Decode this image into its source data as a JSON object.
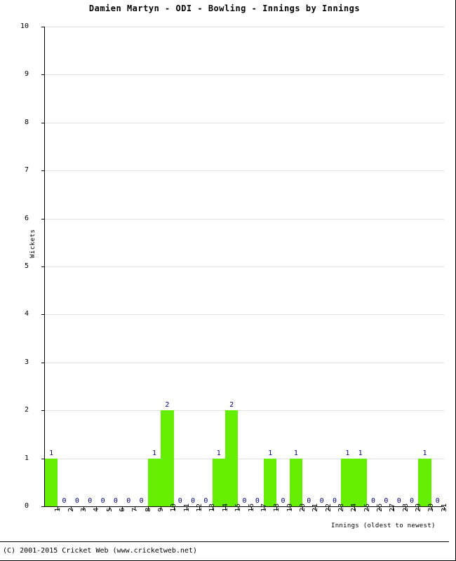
{
  "footer": {
    "copyright": "(C) 2001-2015 Cricket Web (www.cricketweb.net)"
  },
  "colors": {
    "bar": "#66EE00",
    "value_label": "#000080",
    "axis": "#000000",
    "gridline": "#E2E2E2",
    "background": "#FFFFFF"
  },
  "chart_data": {
    "type": "bar",
    "title": "Damien Martyn - ODI - Bowling - Innings by Innings",
    "xlabel": "Innings (oldest to newest)",
    "ylabel": "Wickets",
    "ylim": [
      0,
      10
    ],
    "yticks": [
      0,
      1,
      2,
      3,
      4,
      5,
      6,
      7,
      8,
      9,
      10
    ],
    "grid": true,
    "legend": "none",
    "categories": [
      "1",
      "2",
      "3",
      "4",
      "5",
      "6",
      "7",
      "8",
      "9",
      "10",
      "11",
      "12",
      "13",
      "14",
      "15",
      "16",
      "17",
      "18",
      "19",
      "20",
      "21",
      "22",
      "23",
      "24",
      "25",
      "26",
      "27",
      "28",
      "29",
      "30",
      "31"
    ],
    "values": [
      1,
      0,
      0,
      0,
      0,
      0,
      0,
      0,
      1,
      2,
      0,
      0,
      0,
      1,
      2,
      0,
      0,
      1,
      0,
      1,
      0,
      0,
      0,
      1,
      1,
      0,
      0,
      0,
      0,
      1,
      0
    ],
    "value_labels": [
      "1",
      "0",
      "0",
      "0",
      "0",
      "0",
      "0",
      "0",
      "1",
      "2",
      "0",
      "0",
      "0",
      "1",
      "2",
      "0",
      "0",
      "1",
      "0",
      "1",
      "0",
      "0",
      "0",
      "1",
      "1",
      "0",
      "0",
      "0",
      "0",
      "1",
      "0"
    ]
  }
}
